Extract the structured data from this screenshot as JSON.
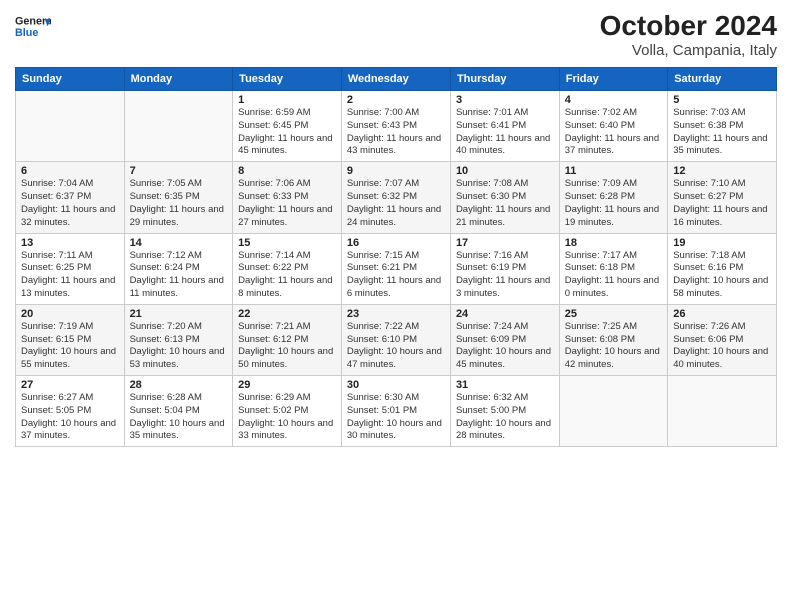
{
  "header": {
    "logo_line1": "General",
    "logo_line2": "Blue",
    "title": "October 2024",
    "subtitle": "Volla, Campania, Italy"
  },
  "columns": [
    "Sunday",
    "Monday",
    "Tuesday",
    "Wednesday",
    "Thursday",
    "Friday",
    "Saturday"
  ],
  "weeks": [
    [
      {
        "day": "",
        "detail": ""
      },
      {
        "day": "",
        "detail": ""
      },
      {
        "day": "1",
        "detail": "Sunrise: 6:59 AM\nSunset: 6:45 PM\nDaylight: 11 hours and 45 minutes."
      },
      {
        "day": "2",
        "detail": "Sunrise: 7:00 AM\nSunset: 6:43 PM\nDaylight: 11 hours and 43 minutes."
      },
      {
        "day": "3",
        "detail": "Sunrise: 7:01 AM\nSunset: 6:41 PM\nDaylight: 11 hours and 40 minutes."
      },
      {
        "day": "4",
        "detail": "Sunrise: 7:02 AM\nSunset: 6:40 PM\nDaylight: 11 hours and 37 minutes."
      },
      {
        "day": "5",
        "detail": "Sunrise: 7:03 AM\nSunset: 6:38 PM\nDaylight: 11 hours and 35 minutes."
      }
    ],
    [
      {
        "day": "6",
        "detail": "Sunrise: 7:04 AM\nSunset: 6:37 PM\nDaylight: 11 hours and 32 minutes."
      },
      {
        "day": "7",
        "detail": "Sunrise: 7:05 AM\nSunset: 6:35 PM\nDaylight: 11 hours and 29 minutes."
      },
      {
        "day": "8",
        "detail": "Sunrise: 7:06 AM\nSunset: 6:33 PM\nDaylight: 11 hours and 27 minutes."
      },
      {
        "day": "9",
        "detail": "Sunrise: 7:07 AM\nSunset: 6:32 PM\nDaylight: 11 hours and 24 minutes."
      },
      {
        "day": "10",
        "detail": "Sunrise: 7:08 AM\nSunset: 6:30 PM\nDaylight: 11 hours and 21 minutes."
      },
      {
        "day": "11",
        "detail": "Sunrise: 7:09 AM\nSunset: 6:28 PM\nDaylight: 11 hours and 19 minutes."
      },
      {
        "day": "12",
        "detail": "Sunrise: 7:10 AM\nSunset: 6:27 PM\nDaylight: 11 hours and 16 minutes."
      }
    ],
    [
      {
        "day": "13",
        "detail": "Sunrise: 7:11 AM\nSunset: 6:25 PM\nDaylight: 11 hours and 13 minutes."
      },
      {
        "day": "14",
        "detail": "Sunrise: 7:12 AM\nSunset: 6:24 PM\nDaylight: 11 hours and 11 minutes."
      },
      {
        "day": "15",
        "detail": "Sunrise: 7:14 AM\nSunset: 6:22 PM\nDaylight: 11 hours and 8 minutes."
      },
      {
        "day": "16",
        "detail": "Sunrise: 7:15 AM\nSunset: 6:21 PM\nDaylight: 11 hours and 6 minutes."
      },
      {
        "day": "17",
        "detail": "Sunrise: 7:16 AM\nSunset: 6:19 PM\nDaylight: 11 hours and 3 minutes."
      },
      {
        "day": "18",
        "detail": "Sunrise: 7:17 AM\nSunset: 6:18 PM\nDaylight: 11 hours and 0 minutes."
      },
      {
        "day": "19",
        "detail": "Sunrise: 7:18 AM\nSunset: 6:16 PM\nDaylight: 10 hours and 58 minutes."
      }
    ],
    [
      {
        "day": "20",
        "detail": "Sunrise: 7:19 AM\nSunset: 6:15 PM\nDaylight: 10 hours and 55 minutes."
      },
      {
        "day": "21",
        "detail": "Sunrise: 7:20 AM\nSunset: 6:13 PM\nDaylight: 10 hours and 53 minutes."
      },
      {
        "day": "22",
        "detail": "Sunrise: 7:21 AM\nSunset: 6:12 PM\nDaylight: 10 hours and 50 minutes."
      },
      {
        "day": "23",
        "detail": "Sunrise: 7:22 AM\nSunset: 6:10 PM\nDaylight: 10 hours and 47 minutes."
      },
      {
        "day": "24",
        "detail": "Sunrise: 7:24 AM\nSunset: 6:09 PM\nDaylight: 10 hours and 45 minutes."
      },
      {
        "day": "25",
        "detail": "Sunrise: 7:25 AM\nSunset: 6:08 PM\nDaylight: 10 hours and 42 minutes."
      },
      {
        "day": "26",
        "detail": "Sunrise: 7:26 AM\nSunset: 6:06 PM\nDaylight: 10 hours and 40 minutes."
      }
    ],
    [
      {
        "day": "27",
        "detail": "Sunrise: 6:27 AM\nSunset: 5:05 PM\nDaylight: 10 hours and 37 minutes."
      },
      {
        "day": "28",
        "detail": "Sunrise: 6:28 AM\nSunset: 5:04 PM\nDaylight: 10 hours and 35 minutes."
      },
      {
        "day": "29",
        "detail": "Sunrise: 6:29 AM\nSunset: 5:02 PM\nDaylight: 10 hours and 33 minutes."
      },
      {
        "day": "30",
        "detail": "Sunrise: 6:30 AM\nSunset: 5:01 PM\nDaylight: 10 hours and 30 minutes."
      },
      {
        "day": "31",
        "detail": "Sunrise: 6:32 AM\nSunset: 5:00 PM\nDaylight: 10 hours and 28 minutes."
      },
      {
        "day": "",
        "detail": ""
      },
      {
        "day": "",
        "detail": ""
      }
    ]
  ]
}
